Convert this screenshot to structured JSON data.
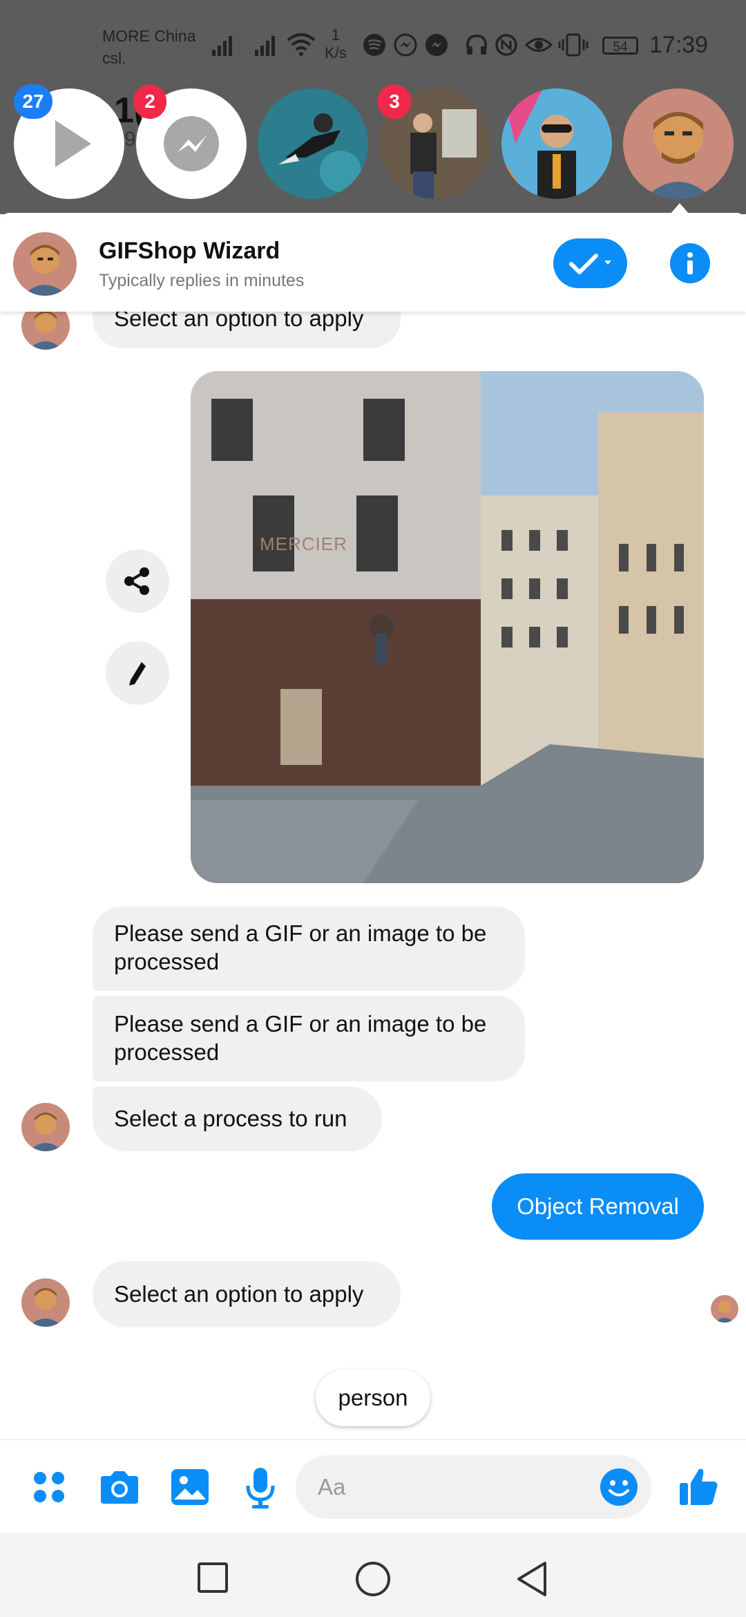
{
  "status_bar": {
    "carrier_line1": "MORE China",
    "carrier_line2": "csl.",
    "net_speed_value": "1",
    "net_speed_unit": "K/s",
    "battery": "54",
    "time": "17:39"
  },
  "background_peek": {
    "title_fragment": "1(          2",
    "sub_fragment": "9"
  },
  "chat_heads": [
    {
      "name": "video-player",
      "badge": "27",
      "badge_color": "#1a7ef5"
    },
    {
      "name": "messenger",
      "badge": "2",
      "badge_color": "#f02849"
    },
    {
      "name": "contact-1",
      "badge": ""
    },
    {
      "name": "contact-2",
      "badge": "3",
      "badge_color": "#f02849"
    },
    {
      "name": "contact-3",
      "badge": ""
    },
    {
      "name": "gifshop-wizard",
      "badge": ""
    }
  ],
  "header": {
    "title": "GIFShop Wizard",
    "subtitle": "Typically replies in minutes"
  },
  "messages": {
    "top_partial": "Select an option to apply",
    "msg1": "Please send a GIF or an image to be processed",
    "msg2": "Please send a GIF or an image to be processed",
    "msg3": "Select a process to run",
    "reply": "Object Removal",
    "msg4": "Select an option to apply"
  },
  "image_sign": "MERCIER",
  "quick_reply": "person",
  "composer": {
    "placeholder": "Aa"
  },
  "colors": {
    "accent": "#0a8df6",
    "badge_red": "#f02849",
    "badge_blue": "#1a7ef5"
  }
}
